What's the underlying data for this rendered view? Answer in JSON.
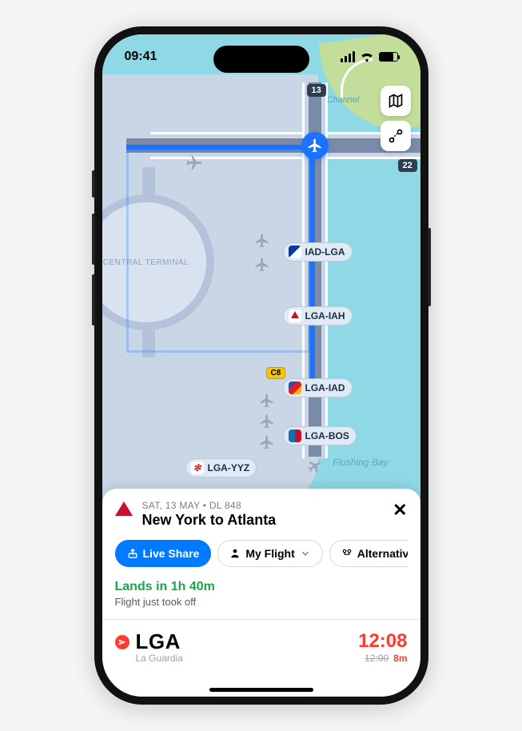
{
  "status": {
    "time": "09:41"
  },
  "map": {
    "runway_labels": {
      "north": "13",
      "east": "22"
    },
    "gate": "C8",
    "terminal_label": "CENTRAL TERMINAL",
    "water_labels": {
      "rikers": "Rikers Island Channel",
      "flushing": "Flushing Bay"
    },
    "flights": [
      {
        "id": "IAD-LGA",
        "icon": "ua"
      },
      {
        "id": "LGA-IAH",
        "icon": "delta"
      },
      {
        "id": "LGA-IAD",
        "icon": "sw"
      },
      {
        "id": "LGA-BOS",
        "icon": "aa"
      },
      {
        "id": "LGA-YYZ",
        "icon": "ac"
      }
    ],
    "buttons": {
      "layers": "layers-icon",
      "route": "route-icon"
    }
  },
  "sheet": {
    "meta": "SAT, 13 MAY • DL 848",
    "title": "New York to Atlanta",
    "pills": {
      "live_share": "Live Share",
      "my_flight": "My Flight",
      "alternatives": "Alternatives"
    },
    "lands_label": "Lands in",
    "lands_value": "1h 40m",
    "sub": "Flight just took off",
    "dep": {
      "code": "LGA",
      "name": "La Guardia",
      "time": "12:08",
      "sched": "12:00",
      "late": "8m"
    }
  }
}
